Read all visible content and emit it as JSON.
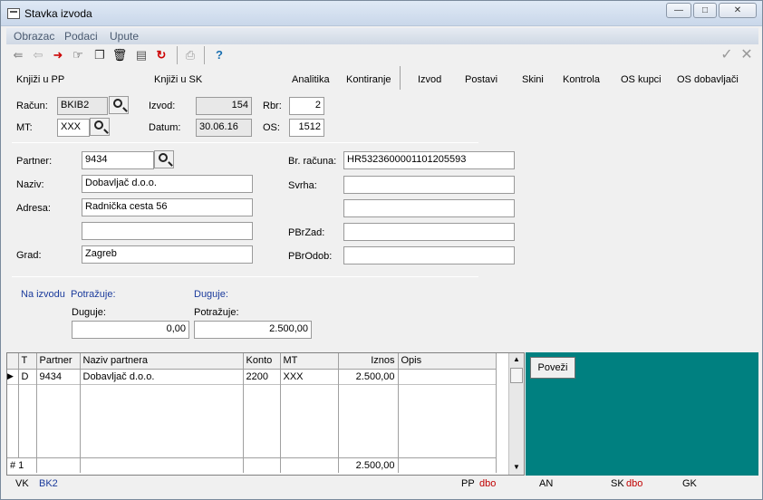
{
  "window": {
    "title": "Stavka izvoda",
    "buttons": [
      "—",
      "□",
      "✕"
    ]
  },
  "menu": [
    "Obrazac",
    "Podaci",
    "Upute"
  ],
  "toolbar": {
    "icons": [
      "exit-icon",
      "back-icon",
      "arrow-right-icon",
      "hand-icon",
      "copy-icon",
      "trash-icon",
      "save-doc-icon",
      "refresh-icon",
      "print-icon",
      "help-icon",
      "check-icon",
      "cancel-x-icon"
    ],
    "help_glyph": "?"
  },
  "actions": {
    "knjizi_pp": "Knjiži u PP",
    "knjizi_sk": "Knjiži u SK",
    "analitika": "Analitika",
    "kontiranje": "Kontiranje",
    "izvod": "Izvod",
    "postavi": "Postavi",
    "skini": "Skini",
    "kontrola": "Kontrola",
    "os_kupci": "OS kupci",
    "os_dobavljaci": "OS dobavljači"
  },
  "header": {
    "racun_label": "Račun:",
    "racun_value": "BKIB2",
    "mt_label": "MT:",
    "mt_value": "XXX",
    "izvod_label": "Izvod:",
    "izvod_value": "154",
    "datum_label": "Datum:",
    "datum_value": "30.06.16",
    "rbr_label": "Rbr:",
    "rbr_value": "2",
    "os_label": "OS:",
    "os_value": "1512"
  },
  "partner": {
    "partner_label": "Partner:",
    "partner_value": "9434",
    "naziv_label": "Naziv:",
    "naziv_value": "Dobavljač d.o.o.",
    "adresa_label": "Adresa:",
    "adresa_value": "Radnička cesta 56",
    "adresa2_value": "",
    "grad_label": "Grad:",
    "grad_value": "Zagreb",
    "br_racuna_label": "Br. računa:",
    "br_racuna_value": "HR5323600001101205593",
    "svrha_label": "Svrha:",
    "svrha_value": "",
    "svrha2_value": "",
    "pbrzad_label": "PBrZad:",
    "pbrzad_value": "",
    "pbrodob_label": "PBrOdob:",
    "pbrodob_value": ""
  },
  "amounts": {
    "na_izvodu": "Na izvodu",
    "potrazuje_head": "Potražuje:",
    "duguje_head": "Duguje:",
    "duguje_label": "Duguje:",
    "duguje_value": "0,00",
    "potrazuje_label": "Potražuje:",
    "potrazuje_value": "2.500,00"
  },
  "grid": {
    "columns": [
      "T",
      "Partner",
      "Naziv partnera",
      "Konto",
      "MT",
      "Iznos",
      "Opis"
    ],
    "rows": [
      {
        "t": "D",
        "partner": "9434",
        "naziv": "Dobavljač d.o.o.",
        "konto": "2200",
        "mt": "XXX",
        "iznos": "2.500,00",
        "opis": ""
      }
    ],
    "footer_count": "# 1",
    "footer_total": "2.500,00"
  },
  "povezi_label": "Poveži",
  "status": {
    "vk_label": "VK",
    "vk_value": "BK2",
    "pp_label": "PP",
    "pp_value": "dbo",
    "an_label": "AN",
    "sk_label": "SK",
    "sk_value": "dbo",
    "gk_label": "GK"
  }
}
